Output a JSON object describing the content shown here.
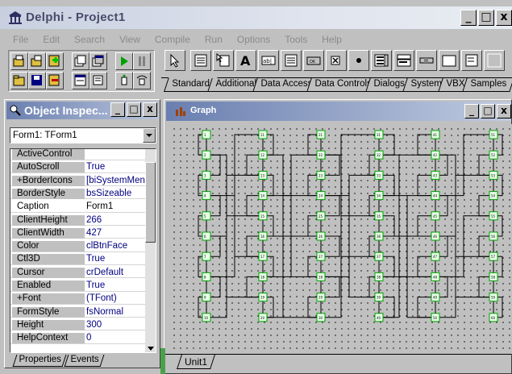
{
  "main_window": {
    "title": "Delphi - Project1",
    "buttons": [
      "_",
      "□",
      "x"
    ]
  },
  "menu": [
    "File",
    "Edit",
    "Search",
    "View",
    "Compile",
    "Run",
    "Options",
    "Tools",
    "Help"
  ],
  "palette": {
    "tabs": [
      "Standard",
      "Additional",
      "Data Access",
      "Data Controls",
      "Dialogs",
      "System",
      "VBX",
      "Samples"
    ],
    "active_tab": "Standard",
    "components": [
      "pointer-icon",
      "mainmenu-icon",
      "popupmenu-icon",
      "label-icon",
      "edit-icon",
      "memo-icon",
      "button-icon",
      "checkbox-icon",
      "radiobutton-icon",
      "listbox-icon",
      "combobox-icon",
      "scrollbar-icon",
      "groupbox-icon",
      "radiogroup-icon",
      "panel-icon"
    ]
  },
  "speedbar": {
    "buttons": [
      "open-project-icon",
      "open-file-icon",
      "add-file-icon",
      "select-unit-icon",
      "select-form-icon",
      "run-icon",
      "pause-icon",
      "save-all-icon",
      "save-file-icon",
      "remove-file-icon",
      "toggle-form-unit-icon",
      "new-form-icon",
      "trace-into-icon",
      "step-over-icon"
    ]
  },
  "object_inspector": {
    "title": "Object Inspec...",
    "selected_object": "Form1: TForm1",
    "properties": [
      {
        "name": "ActiveControl",
        "value": ""
      },
      {
        "name": "AutoScroll",
        "value": "True"
      },
      {
        "name": "+BorderIcons",
        "value": "[biSystemMenu"
      },
      {
        "name": "BorderStyle",
        "value": "bsSizeable"
      },
      {
        "name": "Caption",
        "value": "Form1"
      },
      {
        "name": "ClientHeight",
        "value": "266"
      },
      {
        "name": "ClientWidth",
        "value": "427"
      },
      {
        "name": "Color",
        "value": "clBtnFace"
      },
      {
        "name": "Ctl3D",
        "value": "True"
      },
      {
        "name": "Cursor",
        "value": "crDefault"
      },
      {
        "name": "Enabled",
        "value": "True"
      },
      {
        "name": "+Font",
        "value": "(TFont)"
      },
      {
        "name": "FormStyle",
        "value": "fsNormal"
      },
      {
        "name": "Height",
        "value": "300"
      },
      {
        "name": "HelpContext",
        "value": "0"
      }
    ],
    "selected_property": "Caption",
    "tabs": [
      "Properties",
      "Events"
    ]
  },
  "graph_window": {
    "title": "Graph",
    "unit_tab": "Unit1",
    "columns": [
      {
        "labels": [
          "1",
          "2",
          "3",
          "4",
          "5",
          "6",
          "7",
          "8",
          "9",
          "10"
        ]
      },
      {
        "labels": [
          "11",
          "12",
          "13",
          "14",
          "15",
          "16",
          "17",
          "18",
          "19",
          "20"
        ]
      },
      {
        "labels": [
          "21",
          "22",
          "23",
          "24",
          "25",
          "26",
          "27",
          "28",
          "29",
          "30"
        ]
      },
      {
        "labels": [
          "31",
          "32",
          "33",
          "34",
          "35",
          "36",
          "37",
          "38",
          "39",
          "40"
        ]
      },
      {
        "labels": [
          "41",
          "42",
          "43",
          "44",
          "45",
          "46",
          "47",
          "48",
          "49",
          "50"
        ]
      },
      {
        "labels": [
          "51",
          "52",
          "53",
          "54",
          "55",
          "56",
          "57",
          "58",
          "59",
          "60"
        ]
      }
    ]
  },
  "colors": {
    "active_title_start": "#6a7fb0",
    "node_border": "#00a000",
    "property_value": "#000080",
    "face": "#c0c0c0"
  }
}
